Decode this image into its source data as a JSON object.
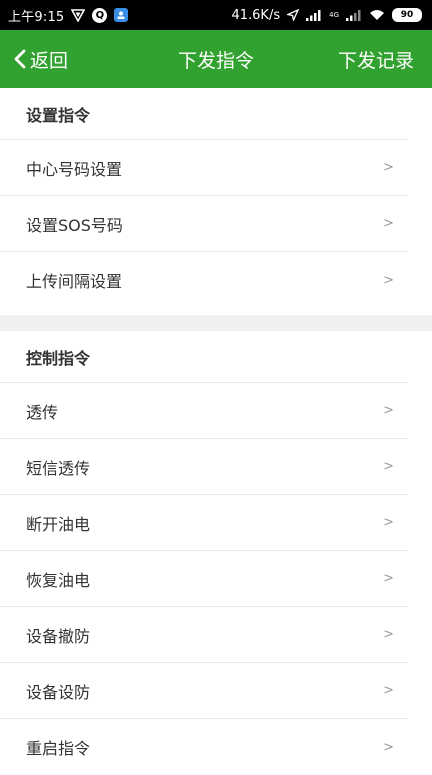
{
  "status_bar": {
    "time": "上午9:15",
    "net_speed": "41.6K/s",
    "network_type": "4G",
    "battery": "90",
    "app_icon_q": "Q",
    "icons": [
      "vpn-shield-icon",
      "q-app-icon",
      "blue-app-icon",
      "location-arrow-icon",
      "signal-icon",
      "wifi-icon",
      "battery-icon"
    ]
  },
  "nav": {
    "back_label": "返回",
    "title": "下发指令",
    "right_label": "下发记录",
    "color": "#31a22f"
  },
  "sections": [
    {
      "title": "设置指令",
      "items": [
        {
          "label": "中心号码设置",
          "chevron": ">"
        },
        {
          "label": "设置SOS号码",
          "chevron": ">"
        },
        {
          "label": "上传间隔设置",
          "chevron": ">"
        }
      ]
    },
    {
      "title": "控制指令",
      "items": [
        {
          "label": "透传",
          "chevron": ">"
        },
        {
          "label": "短信透传",
          "chevron": ">"
        },
        {
          "label": "断开油电",
          "chevron": ">"
        },
        {
          "label": "恢复油电",
          "chevron": ">"
        },
        {
          "label": "设备撤防",
          "chevron": ">"
        },
        {
          "label": "设备设防",
          "chevron": ">"
        },
        {
          "label": "重启指令",
          "chevron": ">"
        }
      ]
    }
  ]
}
